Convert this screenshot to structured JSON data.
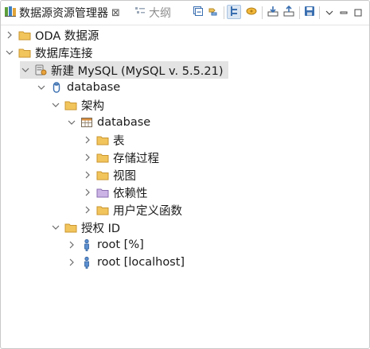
{
  "tabs": {
    "active": {
      "label": "数据源资源管理器",
      "close": "⊠"
    },
    "inactive": {
      "label": "大纲"
    }
  },
  "toolbar": {
    "buttons": [
      {
        "name": "collapse-all-icon"
      },
      {
        "name": "link-with-editor-icon"
      },
      {
        "name": "new-connection-profile-icon",
        "pressed": true
      },
      {
        "name": "connect-icon"
      },
      {
        "name": "import-icon"
      },
      {
        "name": "export-icon"
      },
      {
        "name": "save-icon"
      },
      {
        "name": "view-menu-icon"
      },
      {
        "name": "minimize-icon"
      },
      {
        "name": "maximize-icon"
      }
    ]
  },
  "tree": {
    "rows": [
      {
        "label": "ODA 数据源",
        "icon": "folder-icon",
        "expanded": false
      },
      {
        "label": "数据库连接",
        "icon": "folder-icon",
        "expanded": true
      },
      {
        "label": "新建 MySQL (MySQL v. 5.5.21)",
        "icon": "database-connection-icon",
        "expanded": true,
        "selected": true
      },
      {
        "label": "database",
        "icon": "database-icon",
        "expanded": true
      },
      {
        "label": "架构",
        "icon": "folder-icon",
        "expanded": true
      },
      {
        "label": "database",
        "icon": "schema-icon",
        "expanded": true
      },
      {
        "label": "表",
        "icon": "folder-icon",
        "expanded": false
      },
      {
        "label": "存储过程",
        "icon": "folder-icon",
        "expanded": false
      },
      {
        "label": "视图",
        "icon": "folder-icon",
        "expanded": false
      },
      {
        "label": "依赖性",
        "icon": "dependency-folder-icon",
        "expanded": false
      },
      {
        "label": "用户定义函数",
        "icon": "folder-icon",
        "expanded": false
      },
      {
        "label": "授权 ID",
        "icon": "folder-icon",
        "expanded": true
      },
      {
        "label": "root [%]",
        "icon": "user-icon",
        "expanded": false
      },
      {
        "label": "root [localhost]",
        "icon": "user-icon",
        "expanded": false
      }
    ]
  },
  "colors": {
    "selection": "#e3e3e3",
    "folder": "#f2c55c",
    "folder_border": "#c9952f",
    "dependency_folder": "#cbb3e6",
    "accent_blue": "#3a6fb0"
  }
}
